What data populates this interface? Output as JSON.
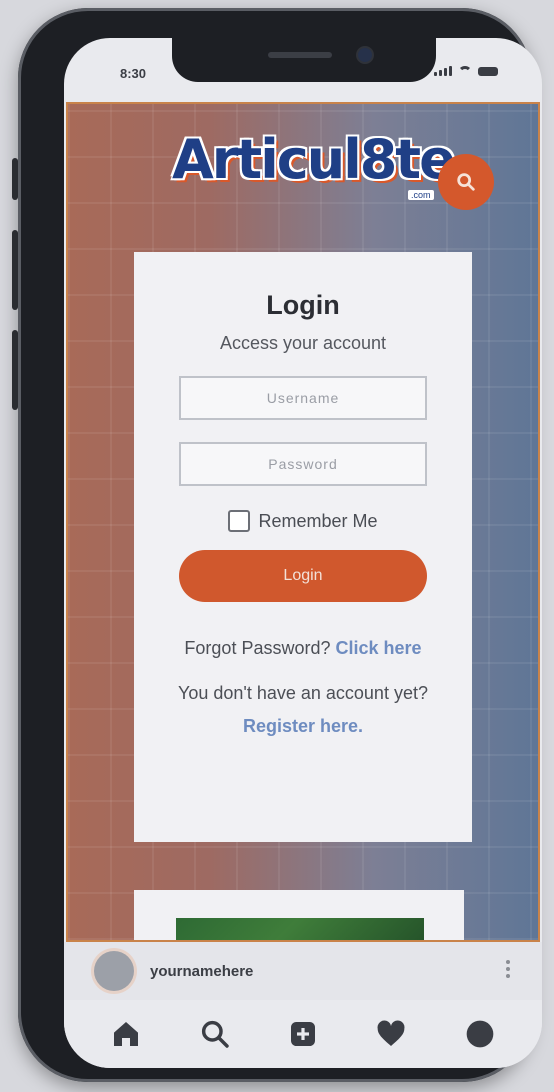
{
  "status_bar": {
    "time": "8:30"
  },
  "site": {
    "logo_text": "Articul8te",
    "logo_sub": ".com",
    "search_icon": "search-icon",
    "accent_color": "#d4582c",
    "brand_color": "#1f3f86"
  },
  "login": {
    "title": "Login",
    "subtitle": "Access your account",
    "username_placeholder": "Username",
    "password_placeholder": "Password",
    "remember_label": "Remember Me",
    "button_label": "Login",
    "forgot_text": "Forgot Password?",
    "forgot_link": "Click here",
    "register_text": "You don't have an account yet?",
    "register_link": "Register here."
  },
  "profile": {
    "username": "yournamehere"
  },
  "tabbar": {
    "items": [
      "home-icon",
      "search-icon",
      "add-post-icon",
      "heart-icon",
      "profile-icon"
    ]
  }
}
